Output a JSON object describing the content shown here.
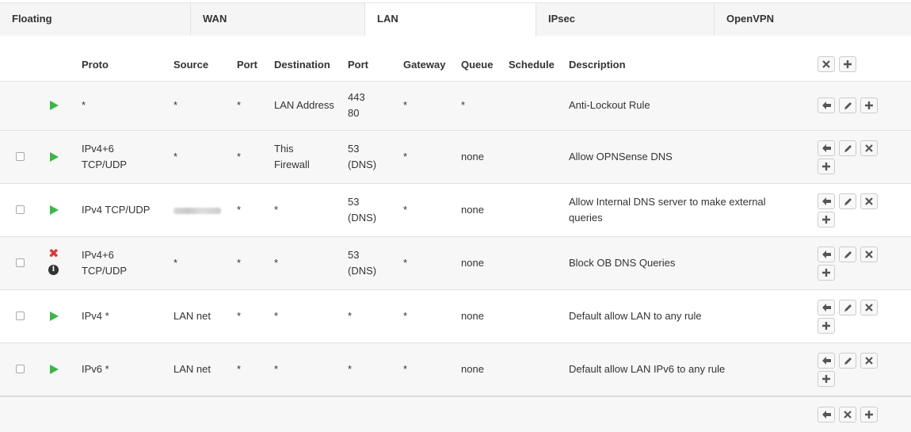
{
  "tabs": [
    {
      "label": "Floating",
      "active": false
    },
    {
      "label": "WAN",
      "active": false
    },
    {
      "label": "LAN",
      "active": true
    },
    {
      "label": "IPsec",
      "active": false
    },
    {
      "label": "OpenVPN",
      "active": false
    }
  ],
  "columns": {
    "proto": "Proto",
    "source": "Source",
    "port": "Port",
    "destination": "Destination",
    "dest_port": "Port",
    "gateway": "Gateway",
    "queue": "Queue",
    "schedule": "Schedule",
    "description": "Description"
  },
  "rules": [
    {
      "action": "pass",
      "proto": [
        "*"
      ],
      "source": "*",
      "port": "*",
      "destination": [
        "LAN Address"
      ],
      "dest_port": [
        "443",
        "80"
      ],
      "gateway": "*",
      "queue": "*",
      "description": "Anti-Lockout Rule"
    },
    {
      "action": "pass",
      "proto": [
        "IPv4+6",
        "TCP/UDP"
      ],
      "source": "*",
      "port": "*",
      "destination": [
        "This",
        "Firewall"
      ],
      "dest_port": [
        "53",
        "(DNS)"
      ],
      "gateway": "*",
      "queue": "none",
      "description": "Allow OPNSense DNS"
    },
    {
      "action": "pass",
      "proto": [
        "IPv4 TCP/UDP"
      ],
      "source": "",
      "port": "*",
      "destination": [
        "*"
      ],
      "dest_port": [
        "53",
        "(DNS)"
      ],
      "gateway": "*",
      "queue": "none",
      "description": "Allow Internal DNS server to make external queries",
      "description_lines": [
        "Allow Internal DNS server to make external",
        "queries"
      ]
    },
    {
      "action": "block",
      "proto": [
        "IPv4+6",
        "TCP/UDP"
      ],
      "source": "*",
      "port": "*",
      "destination": [
        "*"
      ],
      "dest_port": [
        "53",
        "(DNS)"
      ],
      "gateway": "*",
      "queue": "none",
      "description": "Block OB DNS Queries"
    },
    {
      "action": "pass",
      "proto": [
        "IPv4 *"
      ],
      "source": "LAN net",
      "port": "*",
      "destination": [
        "*"
      ],
      "dest_port": [
        "*"
      ],
      "gateway": "*",
      "queue": "none",
      "description": "Default allow LAN to any rule"
    },
    {
      "action": "pass",
      "proto": [
        "IPv6 *"
      ],
      "source": "LAN net",
      "port": "*",
      "destination": [
        "*"
      ],
      "dest_port": [
        "*"
      ],
      "gateway": "*",
      "queue": "none",
      "description": "Default allow LAN IPv6 to any rule"
    }
  ],
  "icons": {
    "pass": "play-icon",
    "block": "x-icon",
    "info": "info-icon",
    "move": "arrow-left-icon",
    "edit": "pencil-icon",
    "delete": "x-icon",
    "add": "plus-icon"
  },
  "colors": {
    "pass": "#3db54a",
    "block": "#e0363a",
    "row_alt": "#f7f7f7",
    "tab_bar": "#f5f5f5"
  }
}
